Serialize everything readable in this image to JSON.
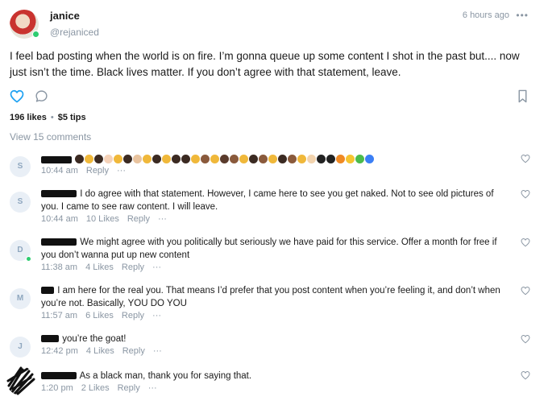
{
  "post": {
    "author_name": "janice",
    "author_handle": "@rejaniced",
    "time": "6 hours ago",
    "more": "•••",
    "text": "I feel bad posting when the world is on fire. I’m gonna queue up some content I shot in the past but.... now just isn’t the time. Black lives matter. If you don’t agree with that statement, leave.",
    "likes": "196 likes",
    "tips": "$5 tips",
    "view_comments": "View 15 comments"
  },
  "icons": {
    "like": "heart-outline-icon",
    "comment": "speech-bubble-icon",
    "bookmark": "bookmark-icon",
    "more": "ellipsis-icon",
    "comment_like": "heart-outline-icon",
    "accent": "#1da1f2",
    "muted": "#8a96a3"
  },
  "comments": [
    {
      "avatar": "S",
      "text": "",
      "emoji_colors": [
        "#3b2a22",
        "#f0b83a",
        "#3b2a22",
        "#f5d2b8",
        "#f0b83a",
        "#3b2a22",
        "#e8c39e",
        "#f0b83a",
        "#3b2a22",
        "#f0b83a",
        "#3b2a22",
        "#3b2a22",
        "#f0b83a",
        "#8a5a3c",
        "#f0b83a",
        "#5a3b2c",
        "#8a5a3c",
        "#f0b83a",
        "#3b2a22",
        "#8a5a3c",
        "#f0b83a",
        "#3b2a22",
        "#8a5a3c",
        "#f0b83a",
        "#f2d3ae",
        "#222222",
        "#222222",
        "#f08a24",
        "#f5c531",
        "#4cbb4c",
        "#3b7ff5"
      ],
      "time": "10:44 am",
      "likes": "",
      "reply": "Reply",
      "more": "···"
    },
    {
      "avatar": "S",
      "text": "I do agree with that statement. However, I came here to see you get naked. Not to see old pictures of you. I came to see raw content. I will leave.",
      "time": "10:44 am",
      "likes": "10 Likes",
      "reply": "Reply",
      "more": "···"
    },
    {
      "avatar": "D",
      "text": "We might agree with you politically but seriously we have paid for this service. Offer a month for free if you don’t wanna put up new content",
      "time": "11:38 am",
      "likes": "4 Likes",
      "reply": "Reply",
      "more": "···"
    },
    {
      "avatar": "M",
      "text": "I am here for the real you. That means I’d prefer that you post content when you’re feeling it, and don’t when you’re not. Basically, YOU DO YOU",
      "time": "11:57 am",
      "likes": "6 Likes",
      "reply": "Reply",
      "more": "···"
    },
    {
      "avatar": "J",
      "text": "you’re the goat!",
      "time": "12:42 pm",
      "likes": "4 Likes",
      "reply": "Reply",
      "more": "···"
    },
    {
      "avatar": "",
      "text": "As a black man, thank you for saying that.",
      "time": "1:20 pm",
      "likes": "2 Likes",
      "reply": "Reply",
      "more": "···"
    }
  ]
}
